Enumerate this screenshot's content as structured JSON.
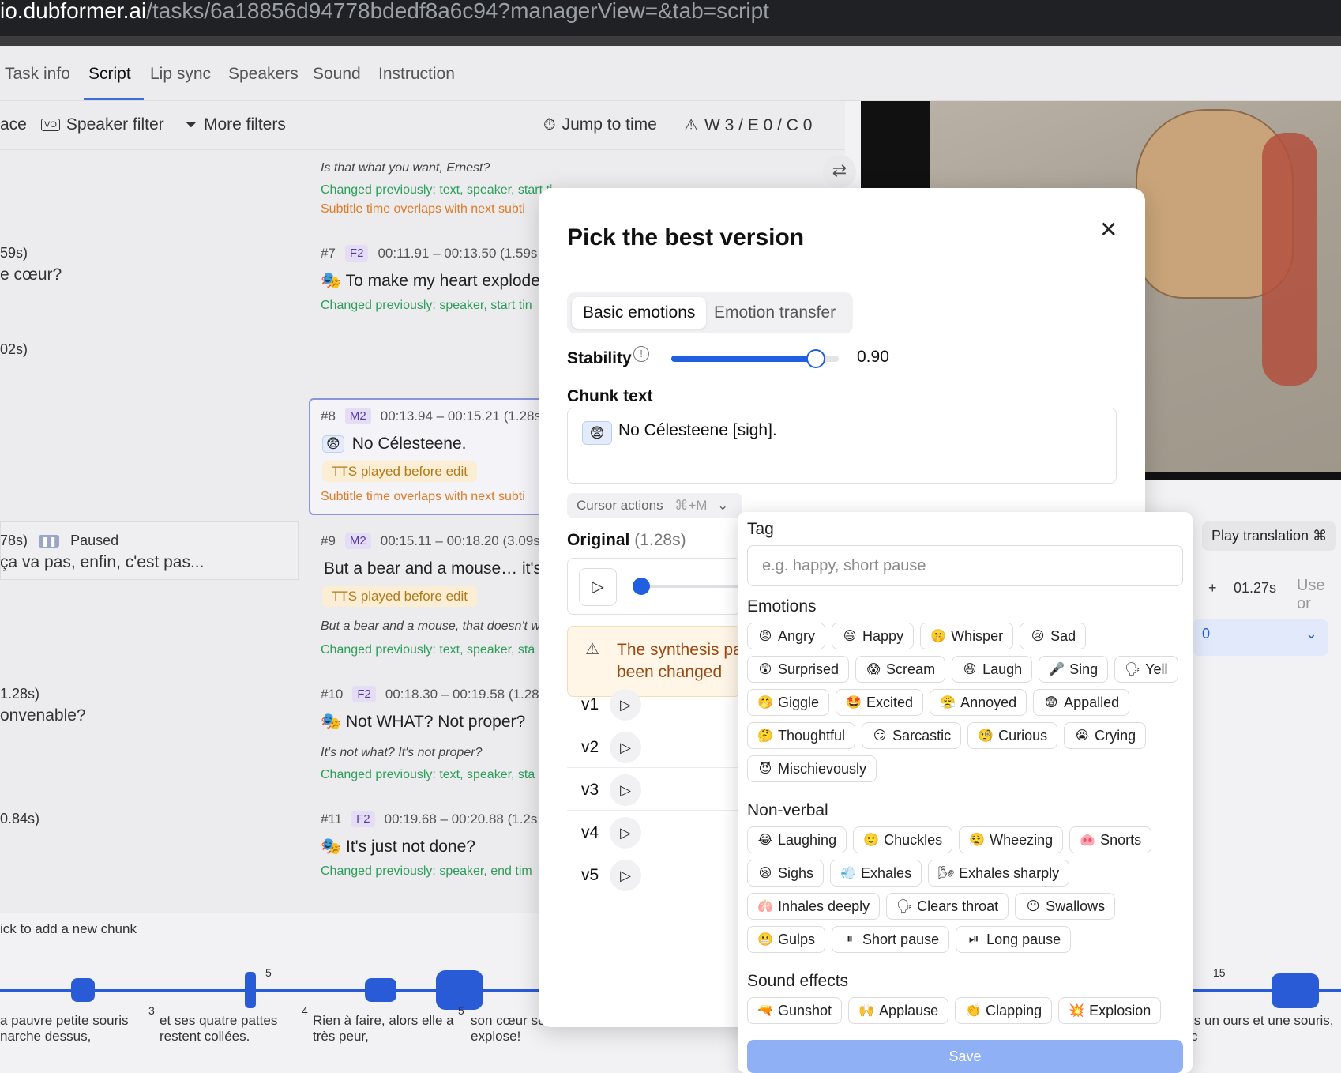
{
  "url": {
    "host": "io.dubformer.ai",
    "path": "/tasks/6a18856d94778bdedf8a6c94?managerView=&tab=script"
  },
  "tabs": [
    "Task info",
    "Script",
    "Lip sync",
    "Speakers",
    "Sound",
    "Instruction"
  ],
  "toolbar": {
    "cut_label": "ace",
    "speaker_filter": "Speaker filter",
    "more_filters": "More filters",
    "jump_to_time": "Jump to time",
    "warnings": "W 3 / E 0 / C 0"
  },
  "left_col": [
    {
      "text": "59s)"
    },
    {
      "text": "e cœur?"
    },
    {
      "text": "02s)"
    },
    {
      "text": "78s)",
      "paused": "Paused"
    },
    {
      "text": "ça va pas, enfin, c'est pas..."
    },
    {
      "text": "1.28s)"
    },
    {
      "text": "onvenable?"
    },
    {
      "text": "0.84s)"
    }
  ],
  "script": {
    "top_italic": "Is that what you want, Ernest?",
    "top_green": "Changed previously: text, speaker, start ti",
    "top_orange": "Subtitle time overlaps with next subti",
    "chunks": [
      {
        "id": "#7",
        "speaker": "F2",
        "time": "00:11.91 – 00:13.50 (1.59s",
        "text": "To make my heart explode",
        "note": "Changed previously: speaker, start tin"
      },
      {
        "id": "#8",
        "speaker": "M2",
        "time": "00:13.94 – 00:15.21 (1.28s",
        "text": "No Célesteene.",
        "tts": "TTS played before edit",
        "orange": "Subtitle time overlaps with next subti"
      },
      {
        "id": "#9",
        "speaker": "M2",
        "time": "00:15.11 – 00:18.20 (3.09s",
        "text": "But a bear and a mouse… it's",
        "tts": "TTS played before edit",
        "italic": "But a bear and a mouse, that doesn't w",
        "note": "Changed previously: text, speaker, sta"
      },
      {
        "id": "#10",
        "speaker": "F2",
        "time": "00:18.30 – 00:19.58 (1.28",
        "text": "Not WHAT? Not proper?",
        "italic": "It's not what? It's not proper?",
        "note": "Changed previously: text, speaker, sta"
      },
      {
        "id": "#11",
        "speaker": "F2",
        "time": "00:19.68 – 00:20.88 (1.2s",
        "text": "It's just not done?",
        "note": "Changed previously: speaker, end tim"
      }
    ],
    "add_chunk": "ick to add a new chunk"
  },
  "waveform": {
    "captions": [
      {
        "line1": "a pauvre petite souris",
        "line2": "narche dessus,"
      },
      {
        "line1": "et ses quatre pattes",
        "line2": "restent collées."
      },
      {
        "line1": "Rien à faire, alors elle a",
        "line2": "très peur,"
      },
      {
        "line1": "son cœur se",
        "line2": "explose!"
      },
      {
        "line1": "is un ours et une souris, c",
        "line2": ""
      }
    ],
    "markers": [
      "3",
      "4",
      "5",
      "5",
      "15"
    ]
  },
  "right_panel": {
    "play_translation": "Play translation",
    "shortcut": "⌘",
    "time": "01.27s",
    "use_label": "Use or",
    "value_fragment": "0"
  },
  "modal": {
    "title": "Pick the best version",
    "segment": [
      "Basic emotions",
      "Emotion transfer"
    ],
    "stability_label": "Stability",
    "stability_value": "0.90",
    "stability_fraction": 0.9,
    "chunk_text_label": "Chunk text",
    "chunk_text_emoji": "😨",
    "chunk_text": "No Célesteene [sigh].",
    "cursor_actions": "Cursor actions",
    "cursor_shortcut": "⌘+M",
    "original_label": "Original",
    "original_duration": "(1.28s)",
    "warning": "The synthesis pa been changed",
    "warning_line1": "The synthesis pa",
    "warning_line2": "been changed",
    "versions": [
      "v1",
      "v2",
      "v3",
      "v4",
      "v5"
    ]
  },
  "tag_dropdown": {
    "tag_label": "Tag",
    "tag_placeholder": "e.g. happy, short pause",
    "emotions_label": "Emotions",
    "emotions": [
      {
        "emoji": "😡",
        "label": "Angry"
      },
      {
        "emoji": "😄",
        "label": "Happy"
      },
      {
        "emoji": "🤫",
        "label": "Whisper"
      },
      {
        "emoji": "😢",
        "label": "Sad"
      },
      {
        "emoji": "😲",
        "label": "Surprised"
      },
      {
        "emoji": "😱",
        "label": "Scream"
      },
      {
        "emoji": "😆",
        "label": "Laugh"
      },
      {
        "emoji": "🎤",
        "label": "Sing"
      },
      {
        "emoji": "🗣",
        "label": "Yell"
      },
      {
        "emoji": "🤭",
        "label": "Giggle"
      },
      {
        "emoji": "🤩",
        "label": "Excited"
      },
      {
        "emoji": "😤",
        "label": "Annoyed"
      },
      {
        "emoji": "😨",
        "label": "Appalled"
      },
      {
        "emoji": "🤔",
        "label": "Thoughtful"
      },
      {
        "emoji": "😏",
        "label": "Sarcastic"
      },
      {
        "emoji": "🧐",
        "label": "Curious"
      },
      {
        "emoji": "😭",
        "label": "Crying"
      },
      {
        "emoji": "😈",
        "label": "Mischievously"
      }
    ],
    "nonverbal_label": "Non-verbal",
    "nonverbal": [
      {
        "emoji": "😂",
        "label": "Laughing"
      },
      {
        "emoji": "🙂",
        "label": "Chuckles"
      },
      {
        "emoji": "😮‍💨",
        "label": "Wheezing"
      },
      {
        "emoji": "🐽",
        "label": "Snorts"
      },
      {
        "emoji": "😪",
        "label": "Sighs"
      },
      {
        "emoji": "💨",
        "label": "Exhales"
      },
      {
        "emoji": "🌬",
        "label": "Exhales sharply"
      },
      {
        "emoji": "🫁",
        "label": "Inhales deeply"
      },
      {
        "emoji": "🗣",
        "label": "Clears throat"
      },
      {
        "emoji": "😶",
        "label": "Swallows"
      },
      {
        "emoji": "😬",
        "label": "Gulps"
      },
      {
        "emoji": "⏸",
        "label": "Short pause"
      },
      {
        "emoji": "⏯",
        "label": "Long pause"
      }
    ],
    "sfx_label": "Sound effects",
    "sfx": [
      {
        "emoji": "🔫",
        "label": "Gunshot"
      },
      {
        "emoji": "🙌",
        "label": "Applause"
      },
      {
        "emoji": "👏",
        "label": "Clapping"
      },
      {
        "emoji": "💥",
        "label": "Explosion"
      }
    ],
    "save": "Save"
  },
  "colors": {
    "accent": "#1f5fe0",
    "save_disabled": "#8fb0f5",
    "green_note": "#2e9e5b",
    "orange_note": "#e07b28"
  }
}
